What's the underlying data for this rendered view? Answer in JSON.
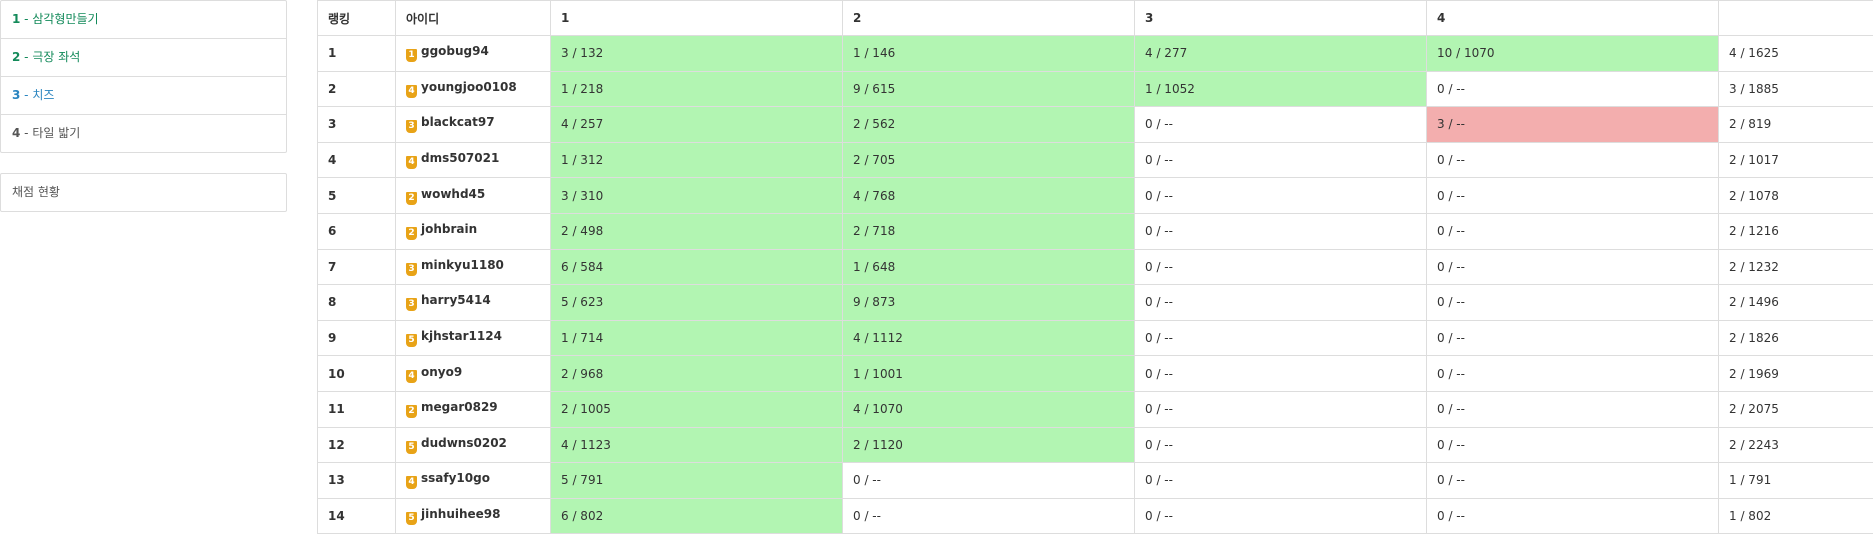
{
  "problems": [
    {
      "num": "1",
      "title": "삼각형만들기",
      "color": "#138a5a"
    },
    {
      "num": "2",
      "title": "극장 좌석",
      "color": "#138a5a"
    },
    {
      "num": "3",
      "title": "치즈",
      "color": "#2a85c0"
    },
    {
      "num": "4",
      "title": "타일 밟기",
      "color": "#555555"
    }
  ],
  "status_label": "채점 현황",
  "table": {
    "headers": [
      "랭킹",
      "아이디",
      "1",
      "2",
      "3",
      "4",
      ""
    ],
    "rows": [
      {
        "rank": "1",
        "tier": "1",
        "user": "ggobug94",
        "p": [
          "3 / 132",
          "1 / 146",
          "4 / 277",
          "10 / 1070"
        ],
        "state": [
          "ac",
          "ac",
          "ac",
          "ac"
        ],
        "total": "4 / 1625"
      },
      {
        "rank": "2",
        "tier": "4",
        "user": "youngjoo0108",
        "p": [
          "1 / 218",
          "9 / 615",
          "1 / 1052",
          "0 / --"
        ],
        "state": [
          "ac",
          "ac",
          "ac",
          "none"
        ],
        "total": "3 / 1885"
      },
      {
        "rank": "3",
        "tier": "3",
        "user": "blackcat97",
        "p": [
          "4 / 257",
          "2 / 562",
          "0 / --",
          "3 / --"
        ],
        "state": [
          "ac",
          "ac",
          "none",
          "wa"
        ],
        "total": "2 / 819"
      },
      {
        "rank": "4",
        "tier": "4",
        "user": "dms507021",
        "p": [
          "1 / 312",
          "2 / 705",
          "0 / --",
          "0 / --"
        ],
        "state": [
          "ac",
          "ac",
          "none",
          "none"
        ],
        "total": "2 / 1017"
      },
      {
        "rank": "5",
        "tier": "2",
        "user": "wowhd45",
        "p": [
          "3 / 310",
          "4 / 768",
          "0 / --",
          "0 / --"
        ],
        "state": [
          "ac",
          "ac",
          "none",
          "none"
        ],
        "total": "2 / 1078"
      },
      {
        "rank": "6",
        "tier": "2",
        "user": "johbrain",
        "p": [
          "2 / 498",
          "2 / 718",
          "0 / --",
          "0 / --"
        ],
        "state": [
          "ac",
          "ac",
          "none",
          "none"
        ],
        "total": "2 / 1216"
      },
      {
        "rank": "7",
        "tier": "3",
        "user": "minkyu1180",
        "p": [
          "6 / 584",
          "1 / 648",
          "0 / --",
          "0 / --"
        ],
        "state": [
          "ac",
          "ac",
          "none",
          "none"
        ],
        "total": "2 / 1232"
      },
      {
        "rank": "8",
        "tier": "3",
        "user": "harry5414",
        "p": [
          "5 / 623",
          "9 / 873",
          "0 / --",
          "0 / --"
        ],
        "state": [
          "ac",
          "ac",
          "none",
          "none"
        ],
        "total": "2 / 1496"
      },
      {
        "rank": "9",
        "tier": "5",
        "user": "kjhstar1124",
        "p": [
          "1 / 714",
          "4 / 1112",
          "0 / --",
          "0 / --"
        ],
        "state": [
          "ac",
          "ac",
          "none",
          "none"
        ],
        "total": "2 / 1826"
      },
      {
        "rank": "10",
        "tier": "4",
        "user": "onyo9",
        "p": [
          "2 / 968",
          "1 / 1001",
          "0 / --",
          "0 / --"
        ],
        "state": [
          "ac",
          "ac",
          "none",
          "none"
        ],
        "total": "2 / 1969"
      },
      {
        "rank": "11",
        "tier": "2",
        "user": "megar0829",
        "p": [
          "2 / 1005",
          "4 / 1070",
          "0 / --",
          "0 / --"
        ],
        "state": [
          "ac",
          "ac",
          "none",
          "none"
        ],
        "total": "2 / 2075"
      },
      {
        "rank": "12",
        "tier": "5",
        "user": "dudwns0202",
        "p": [
          "4 / 1123",
          "2 / 1120",
          "0 / --",
          "0 / --"
        ],
        "state": [
          "ac",
          "ac",
          "none",
          "none"
        ],
        "total": "2 / 2243"
      },
      {
        "rank": "13",
        "tier": "4",
        "user": "ssafy10go",
        "p": [
          "5 / 791",
          "0 / --",
          "0 / --",
          "0 / --"
        ],
        "state": [
          "ac",
          "none",
          "none",
          "none"
        ],
        "total": "1 / 791"
      },
      {
        "rank": "14",
        "tier": "5",
        "user": "jinhuihee98",
        "p": [
          "6 / 802",
          "0 / --",
          "0 / --",
          "0 / --"
        ],
        "state": [
          "ac",
          "none",
          "none",
          "none"
        ],
        "total": "1 / 802"
      }
    ]
  },
  "colors": {
    "accepted": "#b2f5b2",
    "wrong": "#f3aeae",
    "tier_badge": "#e8a317"
  }
}
